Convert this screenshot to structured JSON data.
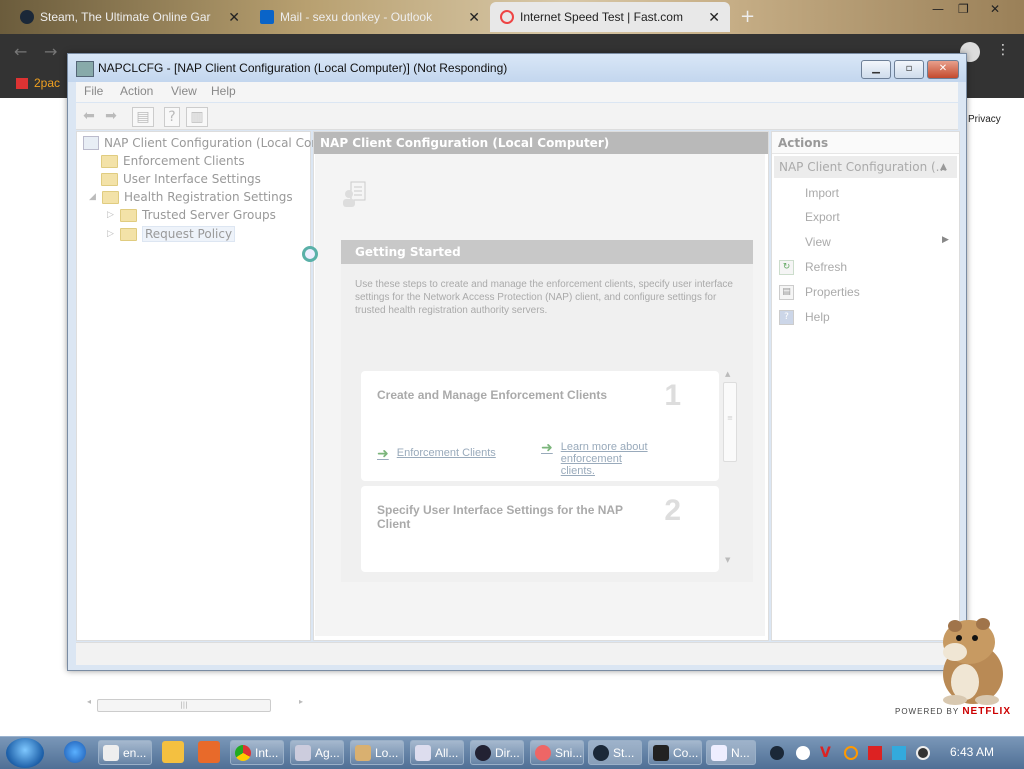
{
  "browser": {
    "tabs": [
      {
        "label": "Steam, The Ultimate Online Gar",
        "active": false
      },
      {
        "label": "Mail - sexu donkey - Outlook",
        "active": false
      },
      {
        "label": "Internet Speed Test | Fast.com",
        "active": true
      }
    ],
    "bookmark_label": "2pac",
    "privacy_link": "Privacy",
    "new_tab": "+"
  },
  "window": {
    "title": "NAPCLCFG - [NAP Client Configuration (Local Computer)] (Not Responding)",
    "menu": [
      "File",
      "Action",
      "View",
      "Help"
    ]
  },
  "tree": {
    "root": "NAP Client Configuration (Local Comp",
    "items": [
      {
        "label": "Enforcement Clients"
      },
      {
        "label": "User Interface Settings"
      },
      {
        "label": "Health Registration Settings"
      },
      {
        "label": "Trusted Server Groups"
      },
      {
        "label": "Request Policy"
      }
    ]
  },
  "center": {
    "header": "NAP Client Configuration (Local Computer)",
    "getting_started": "Getting Started",
    "description": "Use these steps to create and manage the enforcement clients, specify user interface settings for the Network Access Protection (NAP) client, and configure settings for trusted health registration authority servers.",
    "cards": [
      {
        "title": "Create and Manage Enforcement Clients",
        "number": "1",
        "link1": "Enforcement Clients",
        "link2": "Learn more about enforcement clients."
      },
      {
        "title": "Specify User Interface Settings for the NAP Client",
        "number": "2"
      }
    ]
  },
  "actions": {
    "header": "Actions",
    "section": "NAP Client Configuration (...",
    "items": [
      "Import",
      "Export",
      "View",
      "Refresh",
      "Properties",
      "Help"
    ]
  },
  "overlay": {
    "powered_by": "POWERED BY",
    "brand": "NETFLIX"
  },
  "taskbar": {
    "buttons": [
      "en...",
      "Int...",
      "Ag...",
      "Lo...",
      "All...",
      "Dir...",
      "Sni...",
      "St...",
      "Co...",
      "N..."
    ],
    "clock": "6:43 AM"
  }
}
